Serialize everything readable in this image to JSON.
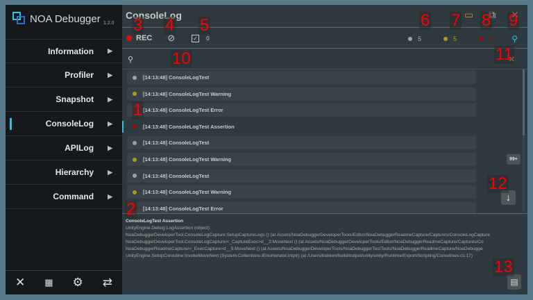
{
  "app": {
    "name": "NOA Debugger",
    "version": "1.2.0"
  },
  "sidebar": {
    "items": [
      {
        "label": "Information"
      },
      {
        "label": "Profiler"
      },
      {
        "label": "Snapshot"
      },
      {
        "label": "ConsoleLog",
        "active": true
      },
      {
        "label": "APILog"
      },
      {
        "label": "Hierarchy"
      },
      {
        "label": "Command"
      }
    ],
    "bottom_icons": [
      "close-icon",
      "grid-icon",
      "gear-icon",
      "swap-icon"
    ]
  },
  "header": {
    "title": "ConsoleLog"
  },
  "toolbar": {
    "rec_label": "REC",
    "collapse_count": "0",
    "counts": {
      "log": "5",
      "warning": "5",
      "error": "3"
    }
  },
  "colors": {
    "log": "#a0a0a0",
    "warning": "#a8a210",
    "error": "#a00d0d",
    "accent": "#35c3dc"
  },
  "logs": [
    {
      "text": "[14:13:48] ConsoleLogTest",
      "type": "log"
    },
    {
      "text": "[14:13:48] ConsoleLogTest Warning",
      "type": "warning"
    },
    {
      "text": "[14:13:48] ConsoleLogTest Error",
      "type": "error"
    },
    {
      "text": "[14:13:48] ConsoleLogTest Assertion",
      "type": "error",
      "selected": true
    },
    {
      "text": "[14:13:48] ConsoleLogTest",
      "type": "log"
    },
    {
      "text": "[14:13:48] ConsoleLogTest Warning",
      "type": "warning"
    },
    {
      "text": "[14:13:48] ConsoleLogTest",
      "type": "log"
    },
    {
      "text": "[14:13:48] ConsoleLogTest Warning",
      "type": "warning"
    },
    {
      "text": "[14:13:48] ConsoleLogTest Error",
      "type": "error"
    }
  ],
  "badge": "99+",
  "detail": {
    "title": "ConsoleLogTest Assertion",
    "lines": [
      "UnityEngine.Debug:LogAssertion (object)",
      "NoaDebuggerDeveloperTool.ConsoleLogCapture:SetupCaptureLogs () (at Assets/NoaDebuggerDeveloperTools/Editor/NoaDebuggerReadmeCapture/Captures/ConsoleLogCapture",
      "NoaDebuggerDeveloperTool.ConsoleLogCapture/<_CaptureExec>d__2:MoveNext () (at Assets/NoaDebuggerDeveloperTools/Editor/NoaDebuggerReadmeCapture/Captures/Co",
      "NoaDebuggerReadmeCapture/<_ExecCapture>d__5:MoveNext () (at Assets/NoaDebuggerDeveloperTools/NoaDebuggerTestTools/NoaDebuggerReadmeCapture/NoaDebugge",
      "UnityEngine.SetupCoroutine:InvokeMoveNext (System.Collections.IEnumerator,intptr) (at /Users/bokken/build/output/unity/unity/Runtime/Export/Scripting/Coroutines.cs:17)"
    ]
  },
  "annotations": [
    "1",
    "2",
    "3",
    "4",
    "5",
    "6",
    "7",
    "8",
    "9",
    "10",
    "11",
    "12",
    "13"
  ]
}
